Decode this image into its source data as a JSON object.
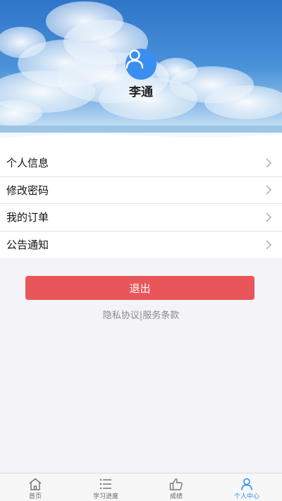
{
  "profile": {
    "username": "李通"
  },
  "menu": {
    "items": [
      {
        "label": "个人信息"
      },
      {
        "label": "修改密码"
      },
      {
        "label": "我的订单"
      },
      {
        "label": "公告通知"
      }
    ]
  },
  "actions": {
    "logout_label": "退出",
    "privacy_label": "隐私协议",
    "separator": "|",
    "terms_label": "服务条款"
  },
  "tabbar": {
    "items": [
      {
        "label": "首页",
        "icon": "home-icon"
      },
      {
        "label": "学习进度",
        "icon": "list-icon"
      },
      {
        "label": "成绩",
        "icon": "thumbs-up-icon"
      },
      {
        "label": "个人中心",
        "icon": "person-icon",
        "active": true
      }
    ]
  },
  "colors": {
    "accent": "#2f8df0",
    "logout": "#e8565a",
    "avatar": "#3b8ef0"
  }
}
